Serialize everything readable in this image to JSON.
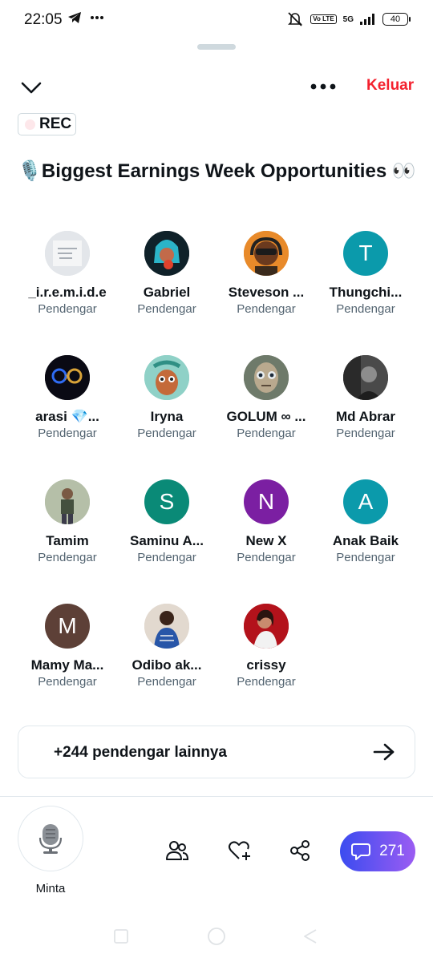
{
  "status": {
    "time": "22:05",
    "volte": "Vo LTE",
    "network": "5G",
    "battery": "40"
  },
  "header": {
    "exit_label": "Keluar"
  },
  "space": {
    "rec_label": "REC",
    "title": "🎙️Biggest Earnings Week Opportunities 👀"
  },
  "listeners": [
    {
      "name": "_i.r.e.m.i.d.e",
      "role": "Pendengar",
      "avatar": "photo-notebook"
    },
    {
      "name": "Gabriel",
      "role": "Pendengar",
      "avatar": "photo-blue-hair"
    },
    {
      "name": "Steveson ...",
      "role": "Pendengar",
      "avatar": "photo-orange-headphones"
    },
    {
      "name": "Thungchi...",
      "role": "Pendengar",
      "letter": "T",
      "color": "#0b9aab"
    },
    {
      "name": "arasi 💎...",
      "role": "Pendengar",
      "avatar": "photo-logo-dark"
    },
    {
      "name": "Iryna",
      "role": "Pendengar",
      "avatar": "photo-cartoon"
    },
    {
      "name": "GOLUM ∞ ...",
      "role": "Pendengar",
      "avatar": "photo-gollum"
    },
    {
      "name": "Md Abrar",
      "role": "Pendengar",
      "avatar": "photo-bw-person"
    },
    {
      "name": "Tamim",
      "role": "Pendengar",
      "avatar": "photo-outdoor-person"
    },
    {
      "name": "Saminu A...",
      "role": "Pendengar",
      "letter": "S",
      "color": "#0a8a77"
    },
    {
      "name": "New X",
      "role": "Pendengar",
      "letter": "N",
      "color": "#7b1fa2"
    },
    {
      "name": "Anak Baik",
      "role": "Pendengar",
      "letter": "A",
      "color": "#0b9aab"
    },
    {
      "name": "Mamy Ma...",
      "role": "Pendengar",
      "letter": "M",
      "color": "#5d4037"
    },
    {
      "name": "Odibo ak...",
      "role": "Pendengar",
      "avatar": "photo-woman-blue"
    },
    {
      "name": "crissy",
      "role": "Pendengar",
      "avatar": "photo-woman-red"
    }
  ],
  "more_listeners": "+244 pendengar lainnya",
  "bottom": {
    "request_label": "Minta",
    "comment_count": "271"
  },
  "colors": {
    "accent_red": "#f4212e",
    "comment_gradient_start": "#3b4cf0",
    "comment_gradient_end": "#9b5cf2"
  }
}
